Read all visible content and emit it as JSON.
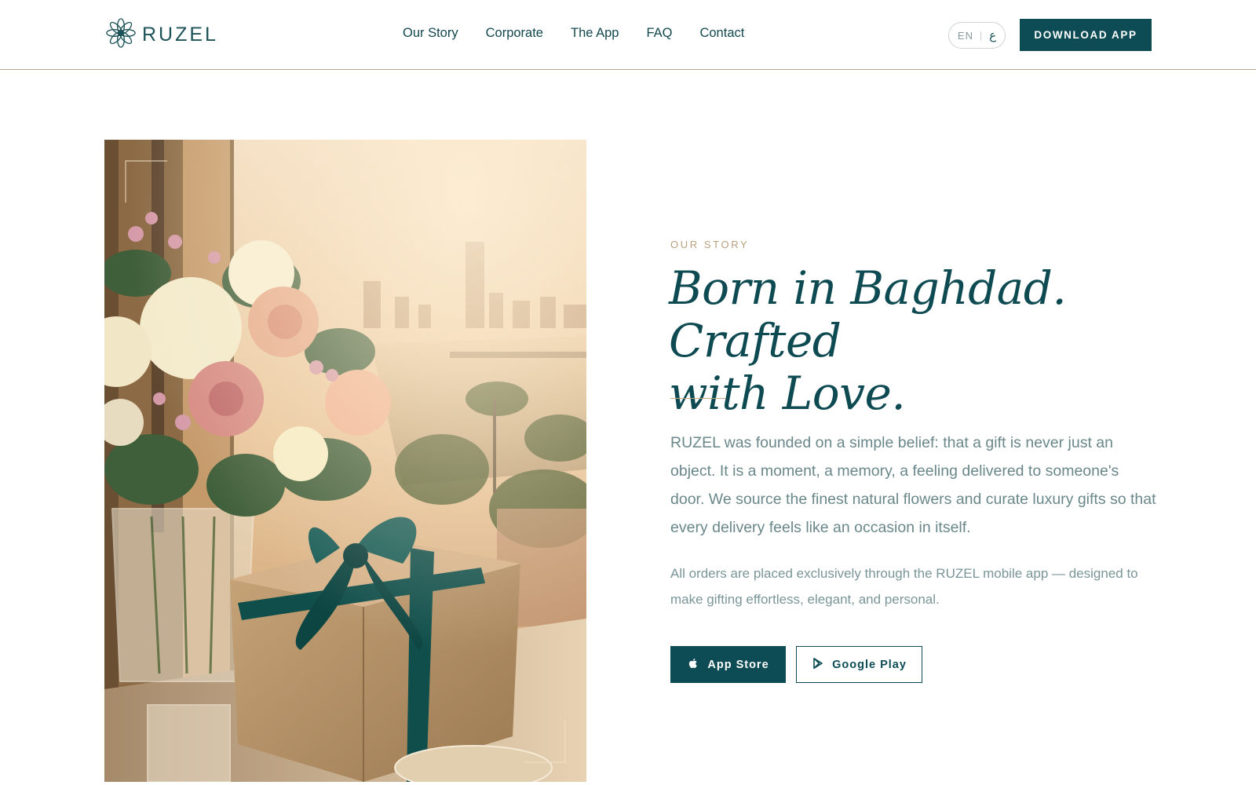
{
  "brand": {
    "name": "RUZEL",
    "logo_icon": "lotus-flower-icon"
  },
  "nav": {
    "items": [
      {
        "label": "Our Story"
      },
      {
        "label": "Corporate"
      },
      {
        "label": "The App"
      },
      {
        "label": "FAQ"
      },
      {
        "label": "Contact"
      }
    ]
  },
  "lang_toggle": {
    "en": "EN",
    "separator": "|",
    "ar": "ع"
  },
  "header_cta": {
    "label": "DOWNLOAD APP"
  },
  "hero_image": {
    "alt": "Flower bouquet and gift box with green ribbon by a window overlooking a river city at sunset"
  },
  "story": {
    "eyebrow": "OUR STORY",
    "headline_line1": "Born in Baghdad. Crafted",
    "headline_line2": "with Love.",
    "body1": "RUZEL was founded on a simple belief: that a gift is never just an object. It is a moment, a memory, a feeling delivered to someone's door. We source the finest natural flowers and curate luxury gifts so that every delivery feels like an occasion in itself.",
    "body2": "All orders are placed exclusively through the RUZEL mobile app — designed to make gifting effortless, elegant, and personal."
  },
  "store_buttons": {
    "app_store": {
      "label": "App Store",
      "icon": "apple-icon"
    },
    "google_play": {
      "label": "Google Play",
      "icon": "google-play-icon"
    }
  },
  "colors": {
    "primary": "#0d4c55",
    "accent_gold": "#b9a07e",
    "body_text": "#6a8789",
    "header_border": "#b7a98f"
  }
}
